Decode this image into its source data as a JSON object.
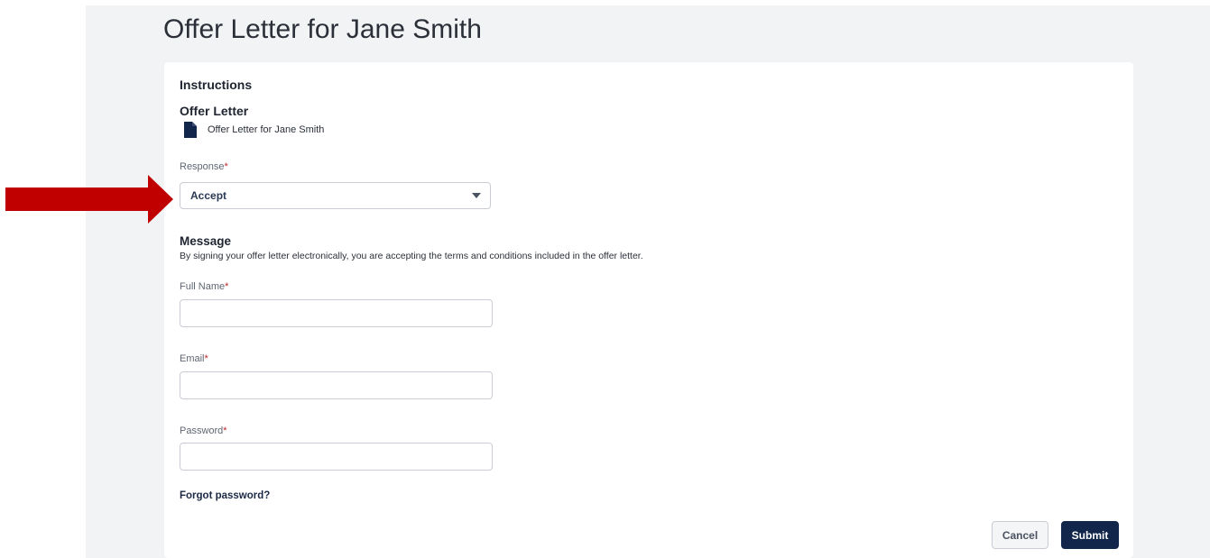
{
  "page": {
    "title": "Offer Letter for Jane Smith"
  },
  "instructions": {
    "heading": "Instructions",
    "offer_letter_heading": "Offer Letter",
    "document_link_label": "Offer Letter for Jane Smith",
    "document_icon": "document-icon"
  },
  "response": {
    "label": "Response",
    "required_mark": "*",
    "selected_value": "Accept",
    "caret_icon": "chevron-down-icon"
  },
  "message": {
    "heading": "Message",
    "description": "By signing your offer letter electronically, you are accepting the terms and conditions included in the offer letter."
  },
  "fields": {
    "full_name": {
      "label": "Full Name",
      "required_mark": "*",
      "value": ""
    },
    "email": {
      "label": "Email",
      "required_mark": "*",
      "value": ""
    },
    "password": {
      "label": "Password",
      "required_mark": "*",
      "value": ""
    }
  },
  "links": {
    "forgot_password": "Forgot password?"
  },
  "actions": {
    "cancel_label": "Cancel",
    "submit_label": "Submit"
  },
  "annotation": {
    "icon": "arrow-right-icon",
    "color": "#c00000"
  },
  "colors": {
    "primary": "#12254a",
    "required": "#c0262d",
    "background": "#f2f3f5"
  }
}
